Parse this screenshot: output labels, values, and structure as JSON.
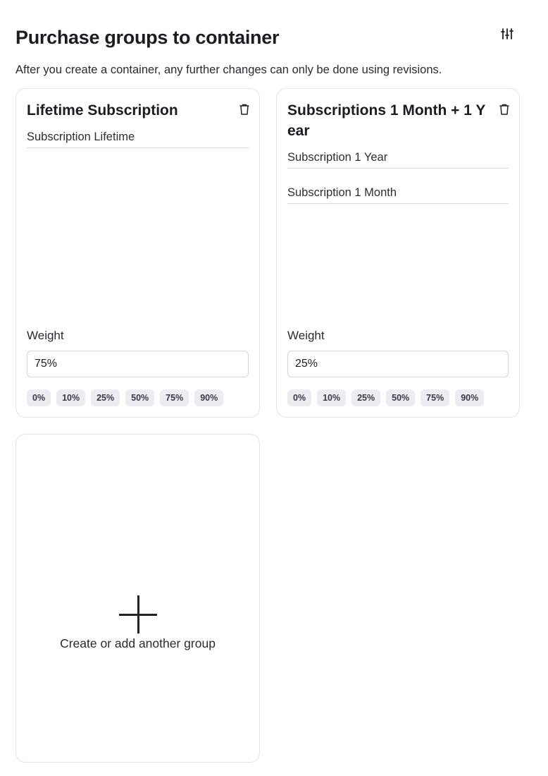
{
  "header": {
    "title": "Purchase groups to container",
    "subtitle": "After you create a container, any further changes can only be done using revisions.",
    "settings_icon": "sliders-icon"
  },
  "groups": [
    {
      "title": "Lifetime Subscription",
      "items": [
        "Subscription Lifetime"
      ],
      "weight_label": "Weight",
      "weight_value": "75%",
      "presets": [
        "0%",
        "10%",
        "25%",
        "50%",
        "75%",
        "90%"
      ]
    },
    {
      "title": "Subscriptions 1 Month + 1 Year",
      "items": [
        "Subscription 1 Year",
        "Subscription 1 Month"
      ],
      "weight_label": "Weight",
      "weight_value": "25%",
      "presets": [
        "0%",
        "10%",
        "25%",
        "50%",
        "75%",
        "90%"
      ]
    }
  ],
  "add_group": {
    "label": "Create or add another group",
    "icon": "plus-icon"
  }
}
